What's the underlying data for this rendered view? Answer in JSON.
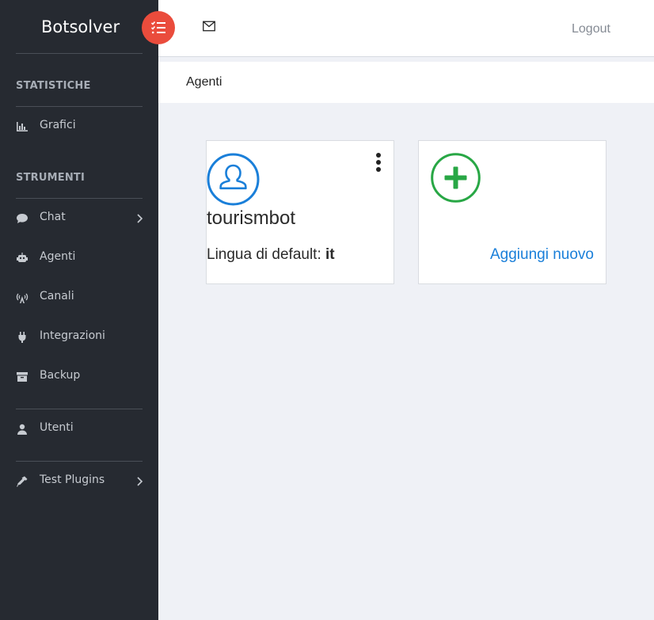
{
  "brand": {
    "name": "Botsolver"
  },
  "sidebar": {
    "sections": [
      {
        "title": "STATISTICHE"
      },
      {
        "title": "STRUMENTI"
      }
    ],
    "items": [
      {
        "label": "Grafici",
        "icon": "bar-chart-icon"
      },
      {
        "label": "Chat",
        "icon": "comment-icon"
      },
      {
        "label": "Agenti",
        "icon": "robot-icon"
      },
      {
        "label": "Canali",
        "icon": "broadcast-tower-icon"
      },
      {
        "label": "Integrazioni",
        "icon": "plug-icon"
      },
      {
        "label": "Backup",
        "icon": "archive-icon"
      },
      {
        "label": "Utenti",
        "icon": "user-icon"
      },
      {
        "label": "Test Plugins",
        "icon": "eyedropper-icon"
      }
    ]
  },
  "header": {
    "logout_label": "Logout"
  },
  "breadcrumb": {
    "title": "Agenti"
  },
  "agents": [
    {
      "name": "tourismbot",
      "lang_label": "Lingua di default:",
      "lang_value": "it"
    }
  ],
  "add_card": {
    "label": "Aggiungi nuovo"
  },
  "colors": {
    "sidebar_bg": "#262a31",
    "accent_red": "#ea4c3c",
    "primary_blue": "#1a7fd9",
    "success_green": "#28a745"
  }
}
